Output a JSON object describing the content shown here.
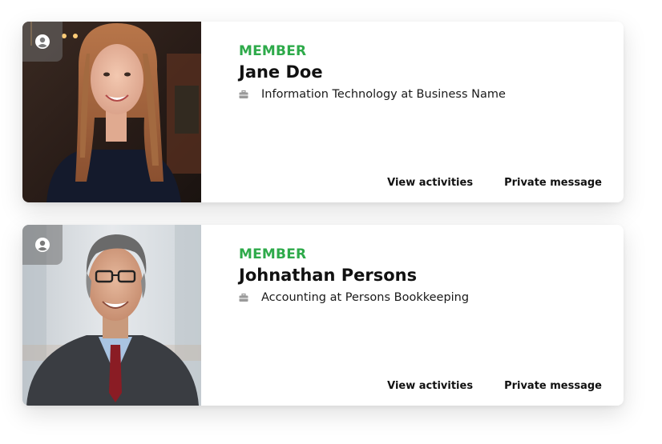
{
  "members": [
    {
      "member_type": "MEMBER",
      "name": "Jane Doe",
      "job": "Information Technology at Business Name",
      "actions": {
        "view_activities": "View activities",
        "private_message": "Private message"
      },
      "photo_icon": "user-circle-icon",
      "job_icon": "briefcase-icon"
    },
    {
      "member_type": "MEMBER",
      "name": "Johnathan Persons",
      "job": "Accounting at Persons Bookkeeping",
      "actions": {
        "view_activities": "View activities",
        "private_message": "Private message"
      },
      "photo_icon": "user-circle-icon",
      "job_icon": "briefcase-icon"
    }
  ],
  "colors": {
    "member_type": "#2eaa4a",
    "text": "#111111",
    "badge_bg": "rgba(110,110,110,0.55)"
  }
}
